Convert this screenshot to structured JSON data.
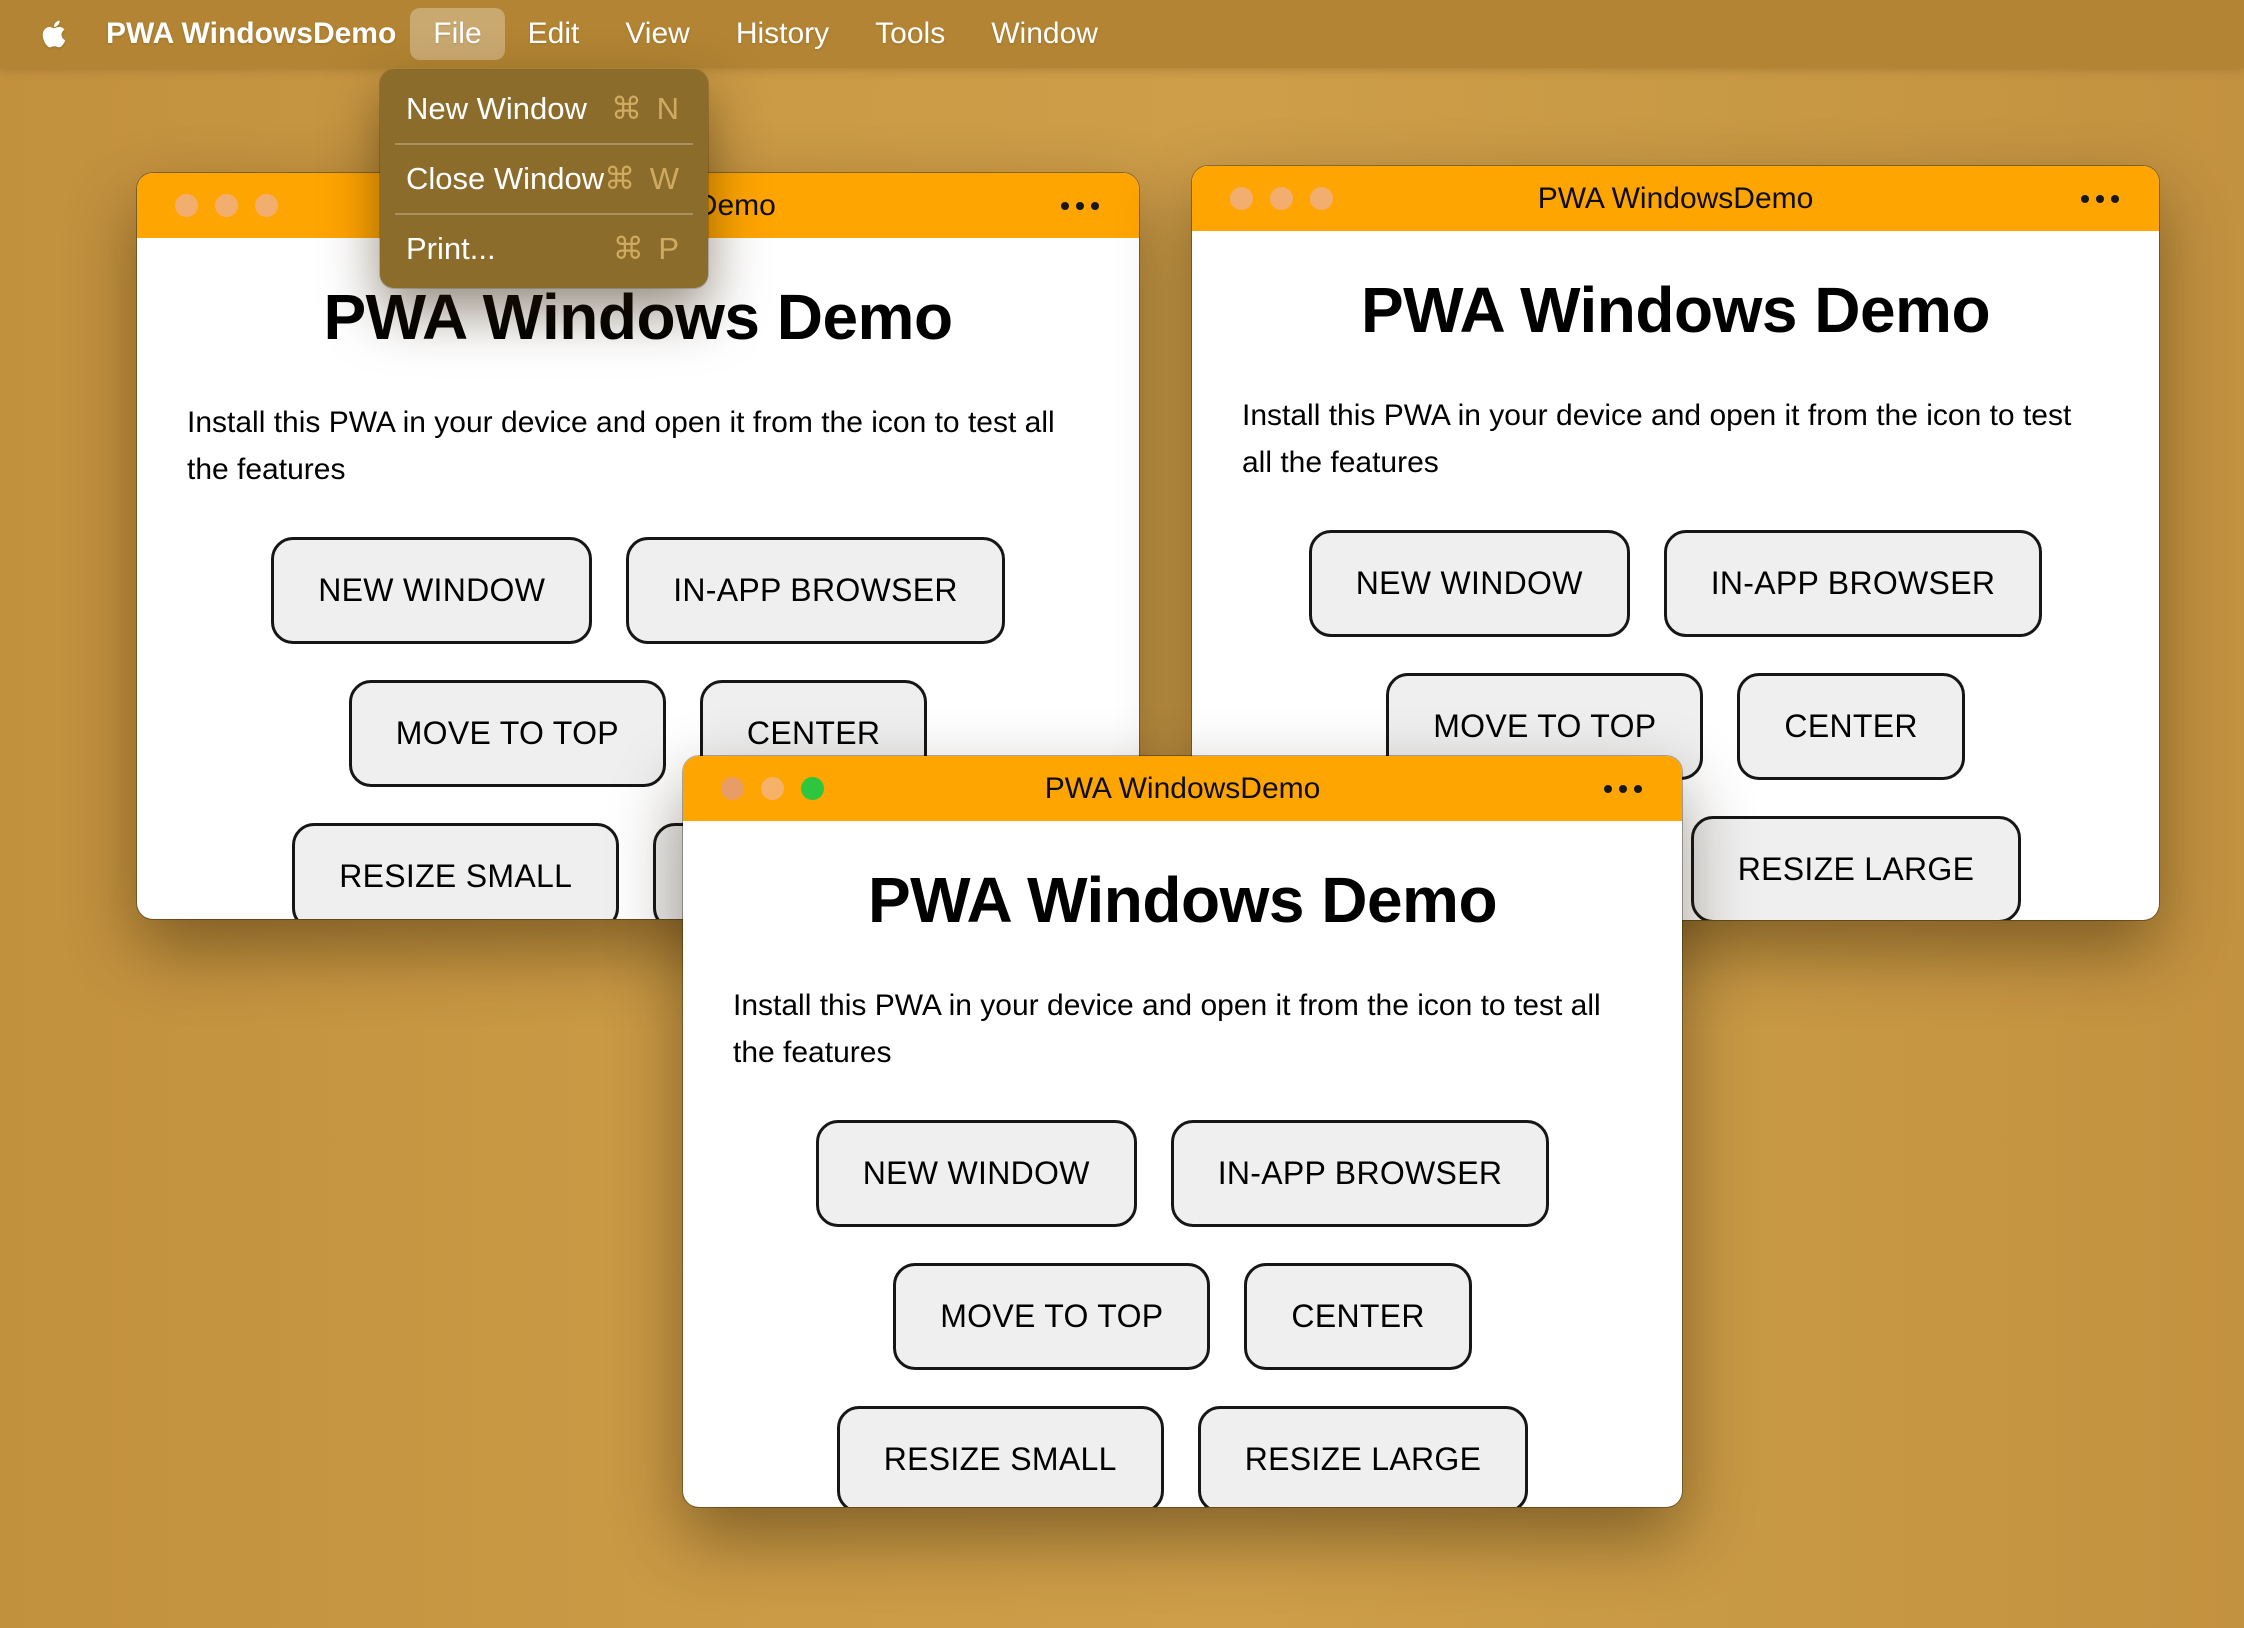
{
  "colors": {
    "desktop": "#c99a45",
    "menubar": "#b28433",
    "menu-panel": "#8c6c2a",
    "titlebar": "#ffa502",
    "window-bg": "#ffffff",
    "button-bg": "#efefef",
    "button-border": "#161616",
    "dot-green": "#2ec53f",
    "dot-inactive": "#f2ae6e",
    "dot-red-active": "#e89d67",
    "dot-yellow-active": "#f6b269"
  },
  "menu_bar": {
    "app_name": "PWA WindowsDemo",
    "items": [
      "File",
      "Edit",
      "View",
      "History",
      "Tools",
      "Window"
    ],
    "active_item": "File"
  },
  "file_menu": {
    "items": [
      {
        "label": "New Window",
        "shortcut": "⌘ N"
      },
      {
        "label": "Close Window",
        "shortcut": "⌘ W"
      },
      {
        "label": "Print...",
        "shortcut": "⌘ P"
      }
    ]
  },
  "window": {
    "title": "PWA WindowsDemo",
    "heading": "PWA Windows Demo",
    "description": "Install this PWA in your device and open it from the icon to test all the features",
    "buttons": [
      "NEW WINDOW",
      "IN-APP BROWSER",
      "MOVE TO TOP",
      "CENTER",
      "RESIZE SMALL",
      "RESIZE LARGE"
    ]
  }
}
